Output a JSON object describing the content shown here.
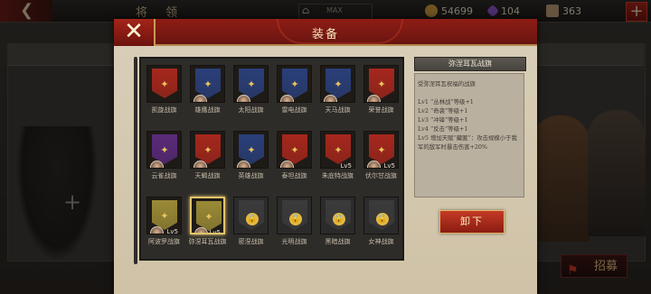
{
  "topbar": {
    "title": "将 领",
    "max_label": "MAX",
    "resources": [
      {
        "icon": "gold-coin-icon",
        "value": "54699",
        "color": "#c69a3e"
      },
      {
        "icon": "purple-gem-icon",
        "value": "104",
        "color": "#8a55c9"
      },
      {
        "icon": "scroll-icon",
        "value": "363",
        "color": "#b69a76"
      }
    ],
    "plus_label": "+"
  },
  "background": {
    "plus_label": "+",
    "recruit_label": "招募"
  },
  "modal": {
    "title": "装备",
    "close_label": "✕",
    "equip_button": "卸下",
    "detail": {
      "title": "弥涅耳瓦战旗",
      "lines": [
        "受弥涅耳瓦祝福的战旗",
        "",
        "Lv1 “丛林战”等级+1",
        "Lv2 “奇袭”等级+1",
        "Lv3 “冲锋”等级+1",
        "Lv4 “反击”等级+1",
        "Lv5 增加天赋“藏匿”：攻击规模小于我军的敌军时暴击伤害+20%"
      ]
    },
    "banners": [
      {
        "name": "凯旋战旗",
        "color": "#a6271c",
        "emblem": "✦",
        "avatar": false,
        "lvl": "",
        "lock": false,
        "selected": false
      },
      {
        "name": "雄鹰战旗",
        "color": "#2a3f7a",
        "emblem": "✦",
        "avatar": true,
        "lvl": "",
        "lock": false,
        "selected": false
      },
      {
        "name": "太阳战旗",
        "color": "#2a3f7a",
        "emblem": "✦",
        "avatar": true,
        "lvl": "",
        "lock": false,
        "selected": false
      },
      {
        "name": "雷电战旗",
        "color": "#2a3f7a",
        "emblem": "✦",
        "avatar": true,
        "lvl": "",
        "lock": false,
        "selected": false
      },
      {
        "name": "天马战旗",
        "color": "#2a3f7a",
        "emblem": "✦",
        "avatar": true,
        "lvl": "",
        "lock": false,
        "selected": false
      },
      {
        "name": "荣誉战旗",
        "color": "#a6271c",
        "emblem": "✦",
        "avatar": true,
        "lvl": "",
        "lock": false,
        "selected": false
      },
      {
        "name": "云雀战旗",
        "color": "#5a2a7a",
        "emblem": "✦",
        "avatar": true,
        "lvl": "",
        "lock": false,
        "selected": false
      },
      {
        "name": "天蝎战旗",
        "color": "#a6271c",
        "emblem": "✦",
        "avatar": true,
        "lvl": "",
        "lock": false,
        "selected": false
      },
      {
        "name": "英雄战旗",
        "color": "#2a3f7a",
        "emblem": "✦",
        "avatar": true,
        "lvl": "",
        "lock": false,
        "selected": false
      },
      {
        "name": "泰坦战旗",
        "color": "#a6271c",
        "emblem": "✦",
        "avatar": true,
        "lvl": "",
        "lock": false,
        "selected": false
      },
      {
        "name": "朱庇特战旗",
        "color": "#a6271c",
        "emblem": "✦",
        "avatar": false,
        "lvl": "Lv5",
        "lock": false,
        "selected": false
      },
      {
        "name": "伏尔甘战旗",
        "color": "#a6271c",
        "emblem": "✦",
        "avatar": true,
        "lvl": "Lv5",
        "lock": false,
        "selected": false
      },
      {
        "name": "阿波罗战旗",
        "color": "#9a8a36",
        "emblem": "✦",
        "avatar": true,
        "lvl": "Lv5",
        "lock": false,
        "selected": false
      },
      {
        "name": "弥涅耳瓦战旗",
        "color": "#9a8a36",
        "emblem": "✦",
        "avatar": true,
        "lvl": "Lv5",
        "lock": false,
        "selected": true
      },
      {
        "name": "密涅战旗",
        "color": "#3a3a3a",
        "emblem": "",
        "avatar": false,
        "lvl": "",
        "lock": true,
        "selected": false
      },
      {
        "name": "光明战旗",
        "color": "#3a3a3a",
        "emblem": "",
        "avatar": false,
        "lvl": "",
        "lock": true,
        "selected": false
      },
      {
        "name": "黑暗战旗",
        "color": "#3a3a3a",
        "emblem": "",
        "avatar": false,
        "lvl": "",
        "lock": true,
        "selected": false
      },
      {
        "name": "女神战旗",
        "color": "#3a3a3a",
        "emblem": "",
        "avatar": false,
        "lvl": "",
        "lock": true,
        "selected": false
      }
    ]
  }
}
